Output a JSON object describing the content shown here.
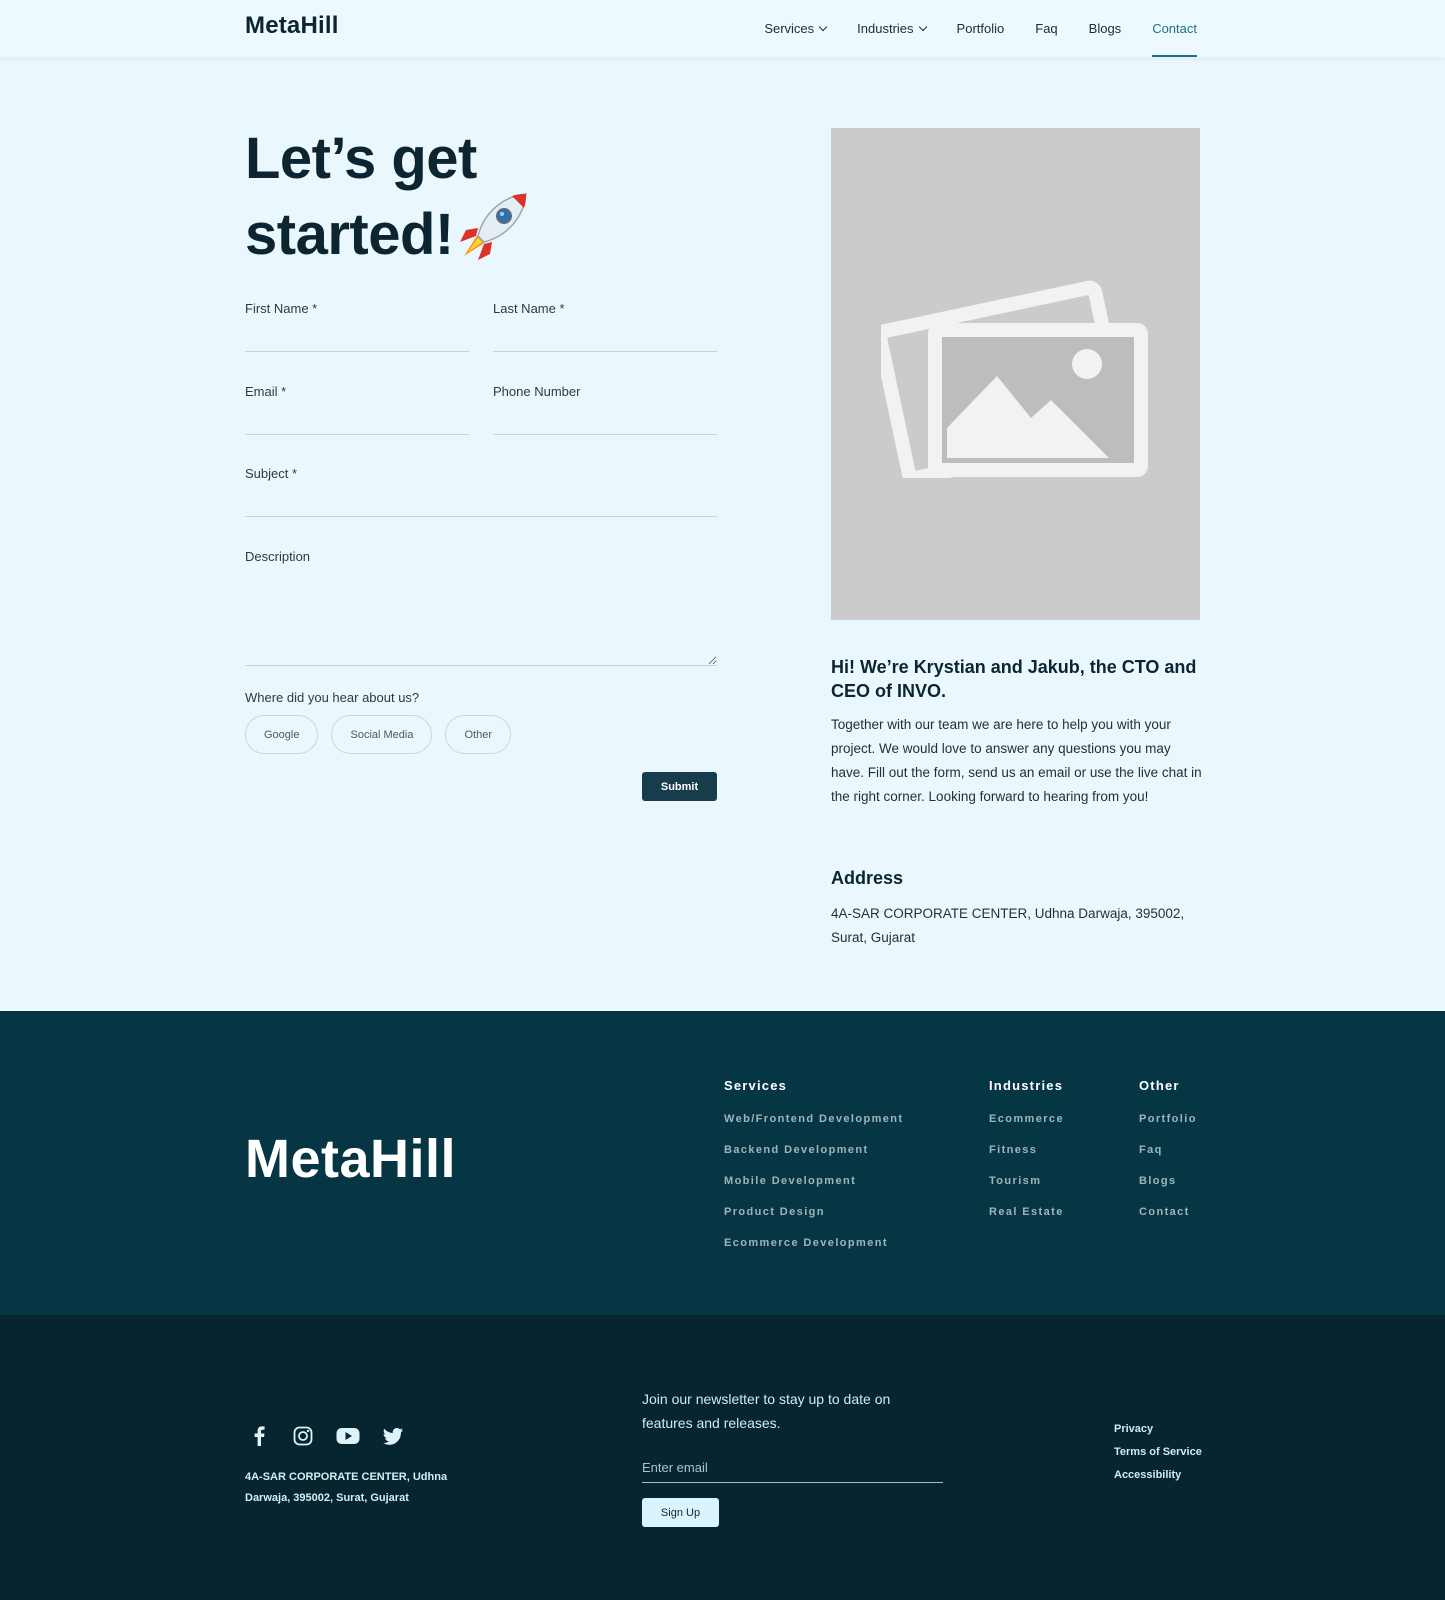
{
  "nav": {
    "logo": "MetaHill",
    "links": [
      {
        "label": "Services"
      },
      {
        "label": "Industries"
      },
      {
        "label": "Portfolio"
      },
      {
        "label": "Faq"
      },
      {
        "label": "Blogs"
      },
      {
        "label": "Contact"
      }
    ]
  },
  "hero": {
    "line1": "Let’s get",
    "line2": "started!"
  },
  "form": {
    "first_name_label": "First Name *",
    "last_name_label": "Last Name *",
    "email_label": "Email *",
    "phone_label": "Phone Number",
    "subject_label": "Subject *",
    "description_label": "Description",
    "hear_label": "Where did you hear about us?",
    "options": [
      "Google",
      "Social Media",
      "Other"
    ],
    "submit_label": "Submit"
  },
  "intro": {
    "title": "Hi! We’re Krystian and Jakub, the CTO and CEO of INVO.",
    "text": "Together with our team we are here to help you with your project. We would love to answer any questions you may have. Fill out the form, send us an email or use the live chat in the right corner. Looking forward to hearing from you!",
    "address_title": "Address",
    "address_text": "4A-SAR CORPORATE CENTER, Udhna Darwaja, 395002, Surat, Gujarat"
  },
  "footer": {
    "logo": "MetaHill",
    "columns": [
      {
        "title": "Services",
        "items": [
          "Web/Frontend Development",
          "Backend Development",
          "Mobile Development",
          "Product Design",
          "Ecommerce Development"
        ]
      },
      {
        "title": "Industries",
        "items": [
          "Ecommerce",
          "Fitness",
          "Tourism",
          "Real Estate"
        ]
      },
      {
        "title": "Other",
        "items": [
          "Portfolio",
          "Faq",
          "Blogs",
          "Contact"
        ]
      }
    ],
    "address": "4A-SAR CORPORATE CENTER, Udhna Darwaja, 395002, Surat, Gujarat",
    "newsletter_text": "Join our newsletter to stay up to date on features and releases.",
    "email_placeholder": "Enter email",
    "signup_label": "Sign Up",
    "legal": [
      "Privacy",
      "Terms of Service",
      "Accessibility"
    ],
    "socials": [
      "facebook-icon",
      "instagram-icon",
      "youtube-icon",
      "twitter-icon"
    ]
  },
  "colors": {
    "page_bg": "#eaf8fd",
    "accent": "#1f6f8b",
    "dark_button": "#173c4c",
    "footer_top": "#063644",
    "footer_bottom": "#062530"
  }
}
